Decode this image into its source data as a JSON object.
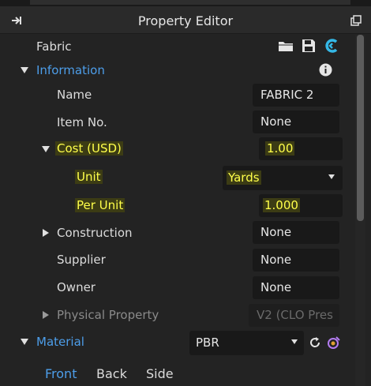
{
  "panel": {
    "title": "Property Editor"
  },
  "header": {
    "name": "Fabric",
    "icons": [
      "folder-icon",
      "save-icon",
      "clo-logo-icon"
    ]
  },
  "information": {
    "label": "Information",
    "name_label": "Name",
    "name_value": "FABRIC 2",
    "item_no_label": "Item No.",
    "item_no_value": "None",
    "cost_label": "Cost (USD)",
    "cost_value": "1.00",
    "unit_label": "Unit",
    "unit_value": "Yards",
    "per_unit_label": "Per Unit",
    "per_unit_value": "1.000",
    "construction_label": "Construction",
    "construction_value": "None",
    "supplier_label": "Supplier",
    "supplier_value": "None",
    "owner_label": "Owner",
    "owner_value": "None",
    "physical_label": "Physical Property",
    "physical_value": "V2 (CLO Pres"
  },
  "material": {
    "label": "Material",
    "type_value": "PBR",
    "tabs": [
      "Front",
      "Back",
      "Side"
    ],
    "active_tab": "Front"
  },
  "colors": {
    "accent": "#4d9eea",
    "highlight": "#ffff4a"
  }
}
